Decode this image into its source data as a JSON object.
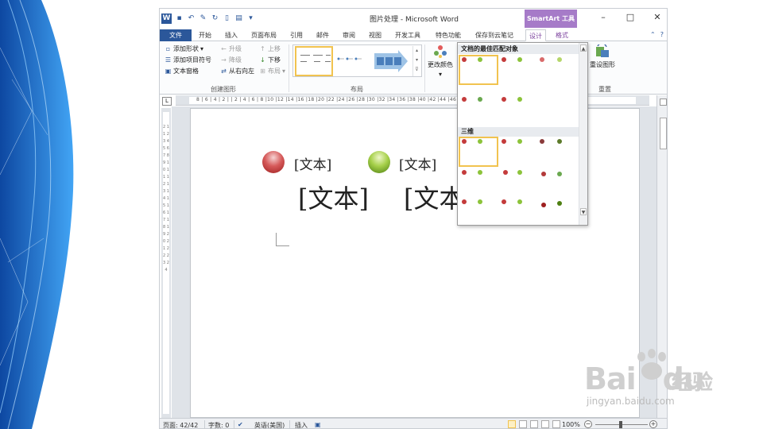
{
  "window": {
    "title": "图片处理 - Microsoft Word",
    "context_tool": "SmartArt 工具"
  },
  "tabs": [
    "文件",
    "开始",
    "插入",
    "页面布局",
    "引用",
    "邮件",
    "审阅",
    "视图",
    "开发工具",
    "特色功能",
    "保存到云笔记",
    "设计",
    "格式"
  ],
  "ribbon": {
    "create_graphic": {
      "add_shape": "添加形状",
      "add_bullet": "添加项目符号",
      "text_pane": "文本窗格",
      "promote": "升级",
      "demote": "降级",
      "rtl": "从右向左",
      "move_up": "上移",
      "move_down": "下移",
      "layout": "布局",
      "group_label": "创建图形"
    },
    "layouts": {
      "group_label": "布局"
    },
    "change_colors": "更改颜色",
    "reset": {
      "reset_graphic": "重设图形",
      "group_label": "重置"
    }
  },
  "ruler_h": "8 | 6 | 4 | 2 |   | 2 | 4 | 6 | 8 |10 |12 |14 |16 |18 |20 |22 |24 |26 |28 |30 |32 |34 |36 |38 |40 |42 |44 |46 |48",
  "ruler_v": "2 1 1 2 3 4 5 6 7 8 9 10 11 12 13 14 15 16 17 18 19 20 21 22 23 24",
  "document": {
    "smartart_label_1": "[文本]",
    "smartart_label_2": "[文本]",
    "text_big_1": "[文本]",
    "text_big_2": "[文本"
  },
  "style_gallery": {
    "section_best_match": "文档的最佳匹配对象",
    "section_3d": "三维"
  },
  "statusbar": {
    "page": "页面: 42/42",
    "word_count": "字数: 0",
    "language": "英语(美国)",
    "mode": "插入",
    "zoom": "100%"
  },
  "watermark": {
    "brand": "Bai",
    "brand2": "du",
    "cn": "经验",
    "url": "jingyan.baidu.com"
  },
  "colors": {
    "accent": "#2b579a",
    "context_tab": "#a67bc8",
    "selection": "#f1c34f",
    "orb_red": "#c43b3b",
    "orb_green": "#8cc33a",
    "deco_blue": "#1e88e5"
  },
  "icons": [
    "word-logo-icon",
    "save-icon",
    "undo-icon",
    "redo-icon",
    "new-doc-icon",
    "print-preview-icon",
    "minimize-icon",
    "restore-icon",
    "close-icon",
    "help-icon",
    "color-palette-icon",
    "reset-graphic-icon"
  ]
}
